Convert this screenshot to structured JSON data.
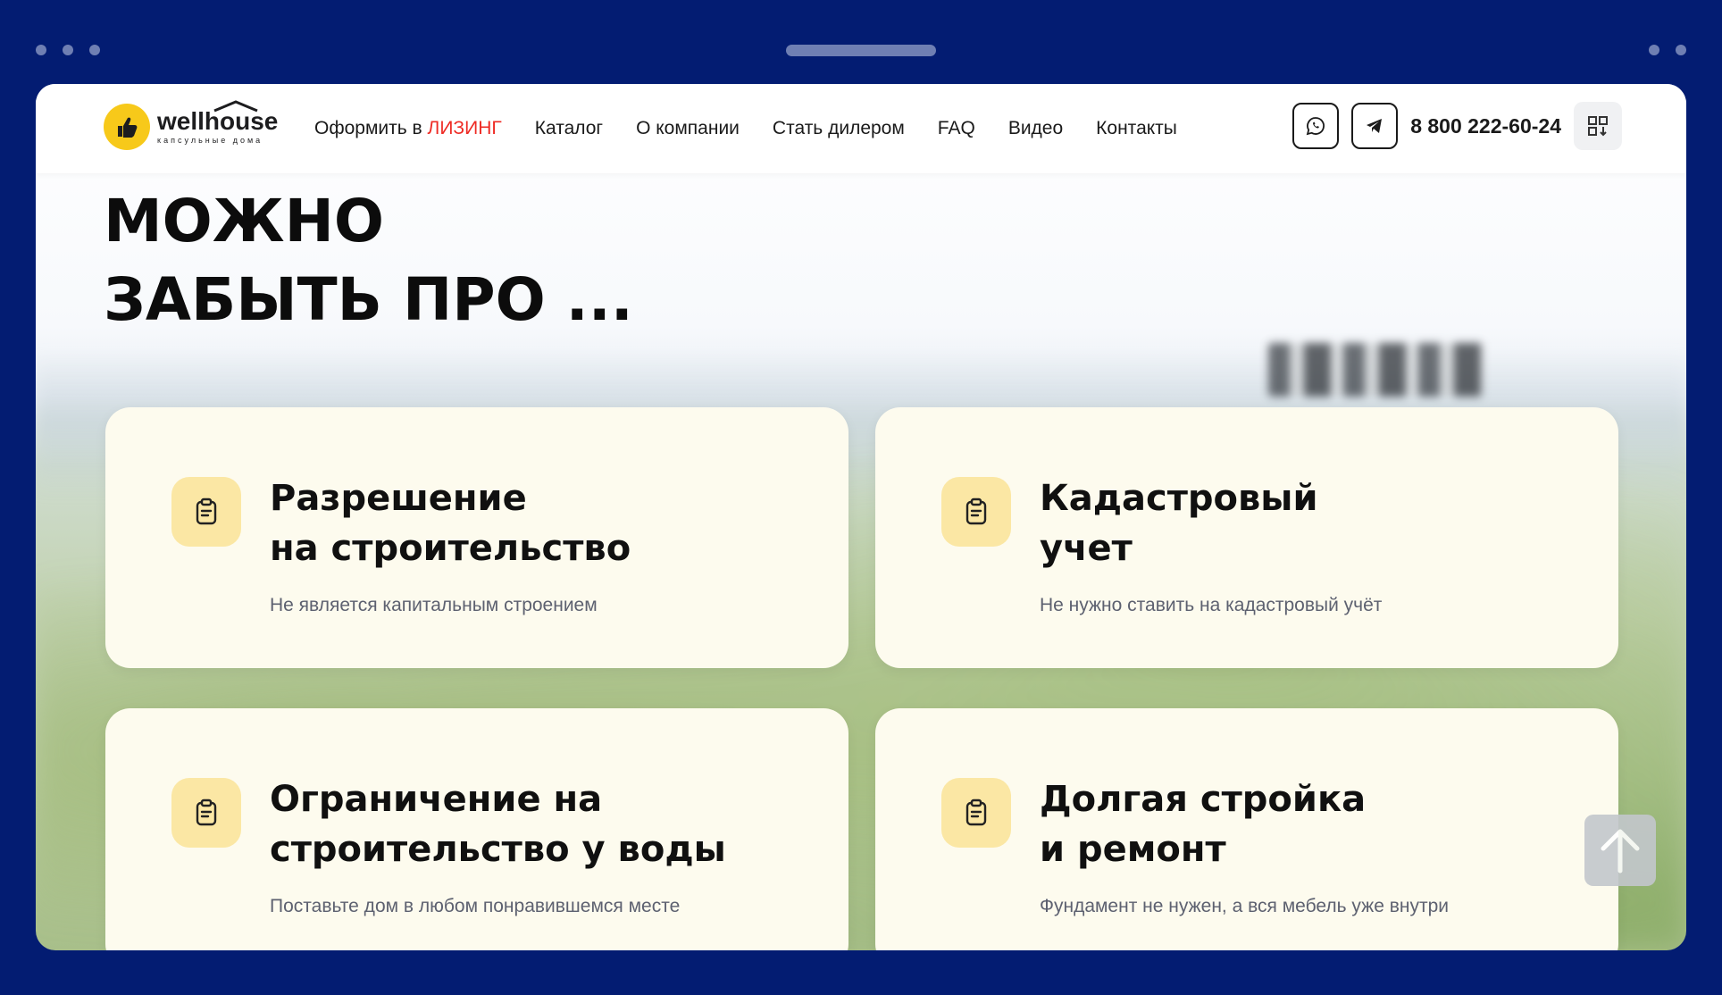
{
  "header": {
    "logo": {
      "name": "wellhouse",
      "subtitle": "капсульные дома"
    },
    "nav": {
      "leasing_prefix": "Оформить в",
      "leasing_accent": "ЛИЗИНГ",
      "items": [
        "Каталог",
        "О компании",
        "Стать дилером",
        "FAQ",
        "Видео",
        "Контакты"
      ]
    },
    "phone": "8 800 222-60-24",
    "icons": {
      "whatsapp": "whatsapp-icon",
      "telegram": "telegram-icon",
      "qr": "qr-code-icon"
    }
  },
  "hero": {
    "line1": "МОЖНО",
    "line2": "ЗАБЫТЬ ПРО ..."
  },
  "cards": [
    {
      "title": "Разрешение\nна строительство",
      "subtitle": "Не является капитальным строением",
      "icon": "clipboard-icon"
    },
    {
      "title": "Кадастровый\nучет",
      "subtitle": "Не нужно ставить на кадастровый учёт",
      "icon": "clipboard-icon"
    },
    {
      "title": "Ограничение на\nстроительство у воды",
      "subtitle": "Поставьте дом в любом понравившемся месте",
      "icon": "clipboard-icon"
    },
    {
      "title": "Долгая стройка\nи ремонт",
      "subtitle": "Фундамент не нужен, а вся мебель уже внутри",
      "icon": "clipboard-icon"
    }
  ],
  "colors": {
    "frame": "#031c72",
    "accent_red": "#ee2b24",
    "logo_yellow": "#f7c91a",
    "card_bg": "#fdfbee",
    "icon_bg": "#fbe7a4"
  }
}
